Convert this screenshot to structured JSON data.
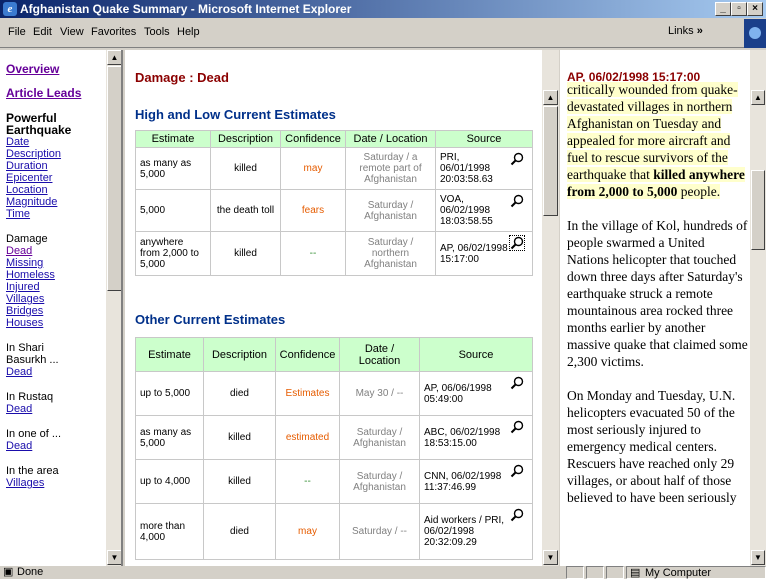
{
  "window": {
    "title": "Afghanistan Quake Summary - Microsoft Internet Explorer",
    "controls": [
      "_",
      "×"
    ]
  },
  "menu": [
    "File",
    "Edit",
    "View",
    "Favorites",
    "Tools",
    "Help"
  ],
  "links_label": "Links",
  "left_nav": {
    "overview": "Overview",
    "article_leads": "Article Leads",
    "section_title": "Powerful Earthquake",
    "section_links": [
      "Date",
      "Description",
      "Duration",
      "Epicenter",
      "Location",
      "Magnitude",
      "Time"
    ],
    "damage_title": "Damage",
    "damage_links": [
      "Dead",
      "Missing",
      "Homeless",
      "Injured",
      "Villages",
      "Bridges",
      "Houses"
    ],
    "groups": [
      {
        "label": "In Shari Basurkh ...",
        "link": "Dead"
      },
      {
        "label": "In Rustaq",
        "link": "Dead"
      },
      {
        "label": "In one of ...",
        "link": "Dead"
      },
      {
        "label": "In the area",
        "link": "Villages"
      }
    ]
  },
  "main": {
    "page_title": "Damage : Dead",
    "high_low_title": "High and Low Current Estimates",
    "other_title": "Other Current Estimates",
    "columns": [
      "Estimate",
      "Description",
      "Confidence",
      "Date / Location",
      "Source"
    ],
    "high_low_rows": [
      {
        "estimate": "as many as 5,000",
        "description": "killed",
        "confidence": "may",
        "conf_color": "orange",
        "date": "Saturday / a remote part of Afghanistan",
        "source": "PRI, 06/01/1998 20:03:58.63"
      },
      {
        "estimate": "5,000",
        "description": "the death toll",
        "confidence": "fears",
        "conf_color": "orange",
        "date": "Saturday / Afghanistan",
        "source": "VOA, 06/02/1998 18:03:58.55"
      },
      {
        "estimate": "anywhere from 2,000 to 5,000",
        "description": "killed",
        "confidence": "--",
        "conf_color": "green",
        "date": "Saturday / northern Afghanistan",
        "source": "AP, 06/02/1998 15:17:00"
      }
    ],
    "other_rows": [
      {
        "estimate": "up to 5,000",
        "description": "died",
        "confidence": "Estimates",
        "conf_color": "orange",
        "date": "May 30 / --",
        "source": "AP, 06/06/1998 05:49:00"
      },
      {
        "estimate": "as many as 5,000",
        "description": "killed",
        "confidence": "estimated",
        "conf_color": "orange",
        "date": "Saturday / Afghanistan",
        "source": "ABC, 06/02/1998 18:53:15.00"
      },
      {
        "estimate": "up to 4,000",
        "description": "killed",
        "confidence": "--",
        "conf_color": "green",
        "date": "Saturday / Afghanistan",
        "source": "CNN, 06/02/1998 11:37:46.99"
      },
      {
        "estimate": "more than 4,000",
        "description": "died",
        "confidence": "may",
        "conf_color": "orange",
        "date": "Saturday / --",
        "source": "Aid workers / PRI, 06/02/1998 20:32:09.29"
      }
    ]
  },
  "article": {
    "header": "AP, 06/02/1998 15:17:00",
    "p1_before": "critically wounded from quake-devastated villages in northern Afghanistan on Tuesday and appealed for more aircraft and fuel to rescue survivors of the earthquake that ",
    "p1_bold": "killed anywhere from 2,000 to 5,000",
    "p1_after": " people.",
    "p2": "In the village of Kol, hundreds of people swarmed a United Nations helicopter that touched down three days after Saturday's earthquake struck a remote mountainous area rocked three months earlier by another massive quake that claimed some 2,300 victims.",
    "p3": "On Monday and Tuesday, U.N. helicopters evacuated 50 of the most seriously injured to emergency medical centers. Rescuers have reached only 29 villages, or about half of those believed to have been seriously"
  },
  "status": {
    "left": "Done",
    "zone": "My Computer"
  }
}
